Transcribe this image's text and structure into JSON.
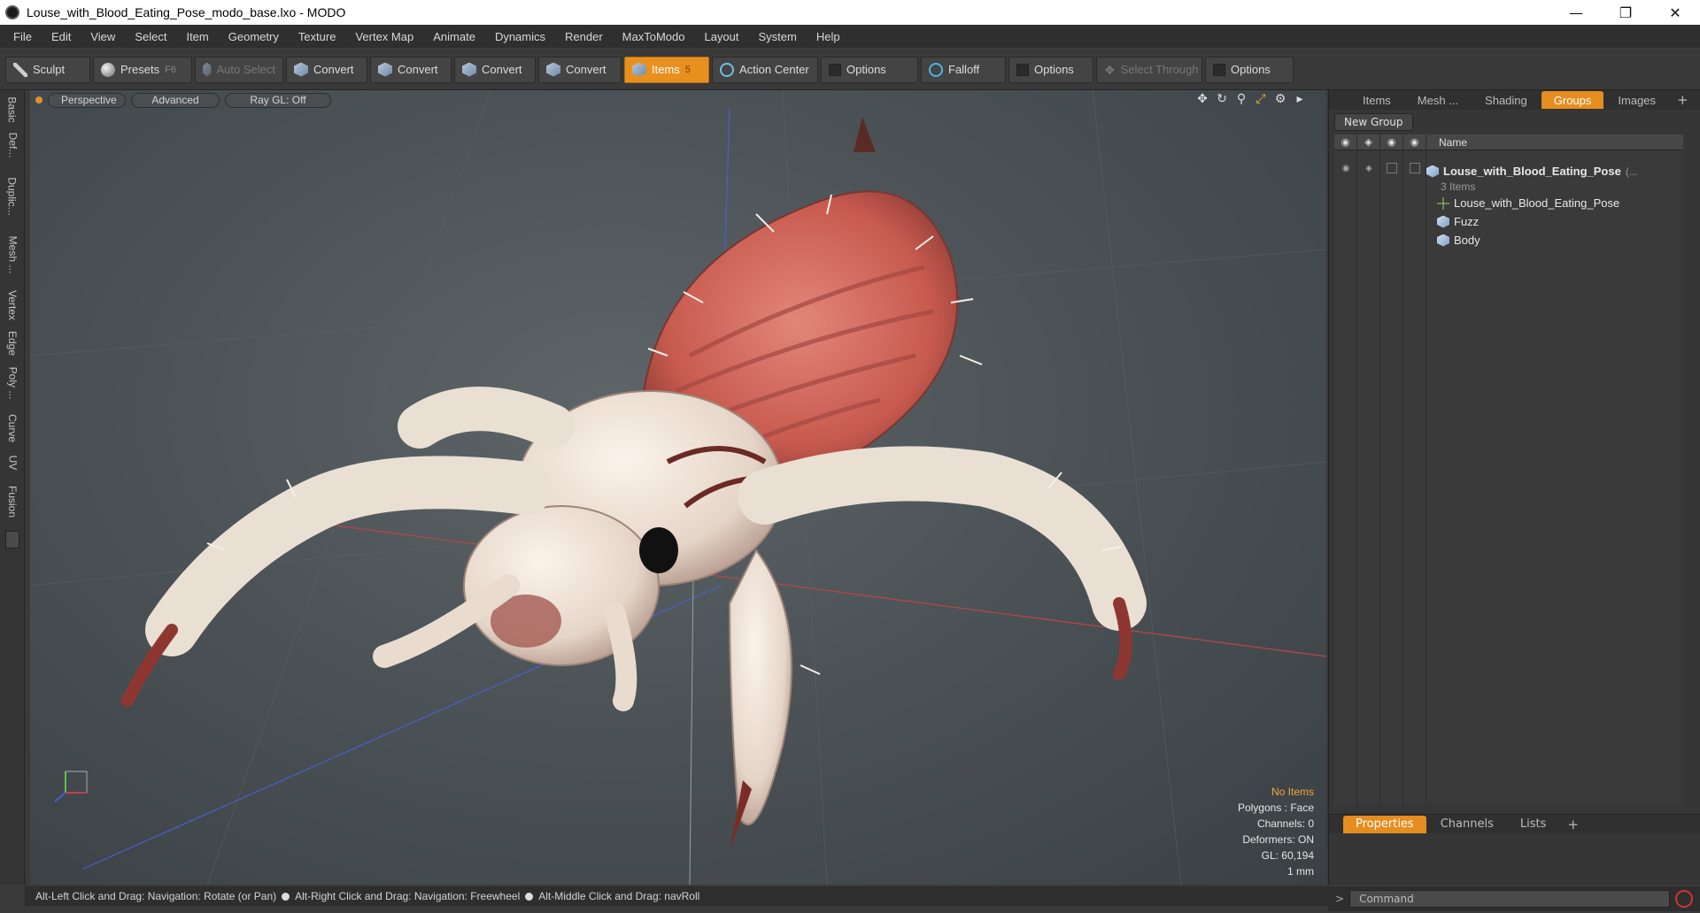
{
  "window": {
    "title": "Louse_with_Blood_Eating_Pose_modo_base.lxo - MODO"
  },
  "menu": [
    "File",
    "Edit",
    "View",
    "Select",
    "Item",
    "Geometry",
    "Texture",
    "Vertex Map",
    "Animate",
    "Dynamics",
    "Render",
    "MaxToModo",
    "Layout",
    "System",
    "Help"
  ],
  "toolbar": {
    "sculpt": "Sculpt",
    "presets": "Presets",
    "presets_key": "F6",
    "auto_select": "Auto Select",
    "convert1": "Convert",
    "convert2": "Convert",
    "convert3": "Convert",
    "convert4": "Convert",
    "items": "Items",
    "items_key": "5",
    "action_center": "Action Center",
    "options1": "Options",
    "falloff": "Falloff",
    "options2": "Options",
    "select_through": "Select Through",
    "options3": "Options"
  },
  "left_tabs": [
    "Basic",
    "Def...",
    "Duplic...",
    "Mesh ...",
    "Vertex",
    "Edge",
    "Poly ...",
    "Curve",
    "UV",
    "Fusion"
  ],
  "viewport": {
    "perspective": "Perspective",
    "advanced": "Advanced",
    "raygl": "Ray GL: Off",
    "info": {
      "no_items": "No Items",
      "polygons": "Polygons : Face",
      "channels": "Channels: 0",
      "deformers": "Deformers: ON",
      "gl": "GL: 60,194",
      "unit": "1 mm"
    }
  },
  "right_panel": {
    "tabs": [
      "Items",
      "Mesh ...",
      "Shading",
      "Groups",
      "Images"
    ],
    "active_tab": "Groups",
    "new_group": "New Group",
    "column_name": "Name",
    "group": {
      "name": "Louse_with_Blood_Eating_Pose",
      "suffix": "(...",
      "count": "3 Items"
    },
    "children": [
      "Louse_with_Blood_Eating_Pose",
      "Fuzz",
      "Body"
    ],
    "bottom_tabs": [
      "Properties",
      "Channels",
      "Lists"
    ]
  },
  "status": {
    "hint1": "Alt-Left Click and Drag: Navigation: Rotate (or Pan)",
    "hint2": "Alt-Right Click and Drag: Navigation: Freewheel",
    "hint3": "Alt-Middle Click and Drag: navRoll"
  },
  "command": {
    "placeholder": "Command"
  },
  "colors": {
    "accent": "#e58d1f",
    "info_highlight": "#f2a53a"
  }
}
